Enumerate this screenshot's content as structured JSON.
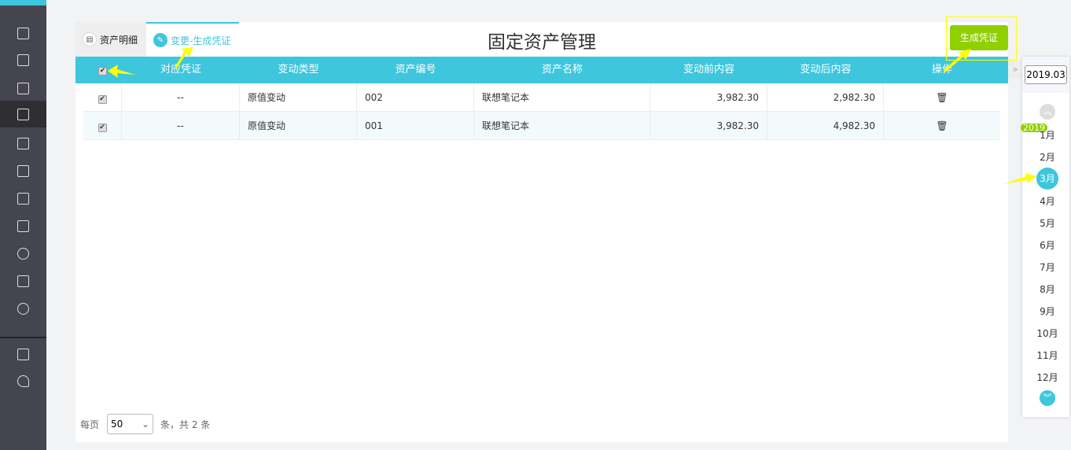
{
  "sidebar": {
    "items": [
      "list-icon",
      "invoice-icon",
      "chart-icon",
      "building-icon",
      "calendar-icon",
      "voucher-icon",
      "receipt-icon",
      "report-icon",
      "coins-icon",
      "export-icon",
      "gear-icon",
      "video-icon",
      "cloud-icon"
    ],
    "active": "building-icon"
  },
  "tabs": [
    {
      "label": "资产明细",
      "icon": "list-icon"
    },
    {
      "label": "变更-生成凭证",
      "icon": "edit-icon",
      "active": true
    }
  ],
  "title": "固定资产管理",
  "generate_button": "生成凭证",
  "table": {
    "headers": [
      "对应凭证",
      "变动类型",
      "资产编号",
      "资产名称",
      "变动前内容",
      "变动后内容",
      "操作"
    ],
    "rows": [
      {
        "checked": true,
        "voucher": "--",
        "type": "原值变动",
        "code": "002",
        "name": "联想笔记本",
        "before": "3,982.30",
        "after": "2,982.30"
      },
      {
        "checked": true,
        "voucher": "--",
        "type": "原值变动",
        "code": "001",
        "name": "联想笔记本",
        "before": "3,982.30",
        "after": "4,982.30"
      }
    ]
  },
  "footer": {
    "per_page_label": "每页",
    "per_page": "50",
    "total_text": "条，共 2 条"
  },
  "period": {
    "value": "2019.03",
    "year": "2019",
    "months": [
      "1月",
      "2月",
      "3月",
      "4月",
      "5月",
      "6月",
      "7月",
      "8月",
      "9月",
      "10月",
      "11月",
      "12月"
    ],
    "active": "3月"
  },
  "colors": {
    "accent": "#3ec6dc",
    "green": "#8fd000",
    "sidebar": "#45454f"
  }
}
